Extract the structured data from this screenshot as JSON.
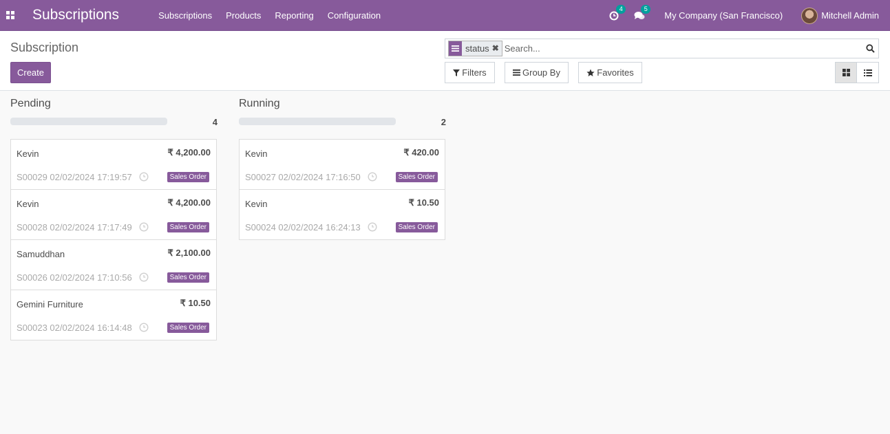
{
  "navbar": {
    "app_title": "Subscriptions",
    "menu": [
      "Subscriptions",
      "Products",
      "Reporting",
      "Configuration"
    ],
    "activity_count": "4",
    "messages_count": "5",
    "company": "My Company (San Francisco)",
    "user": "Mitchell Admin"
  },
  "control_panel": {
    "breadcrumb": "Subscription",
    "create_label": "Create",
    "facet_label": "status",
    "search_placeholder": "Search...",
    "filters_label": "Filters",
    "group_by_label": "Group By",
    "favorites_label": "Favorites"
  },
  "columns": [
    {
      "title": "Pending",
      "count": "4",
      "cards": [
        {
          "name": "Kevin",
          "amount": "₹ 4,200.00",
          "ref": "S00029 02/02/2024 17:19:57",
          "tag": "Sales Order"
        },
        {
          "name": "Kevin",
          "amount": "₹ 4,200.00",
          "ref": "S00028 02/02/2024 17:17:49",
          "tag": "Sales Order"
        },
        {
          "name": "Samuddhan",
          "amount": "₹ 2,100.00",
          "ref": "S00026 02/02/2024 17:10:56",
          "tag": "Sales Order"
        },
        {
          "name": "Gemini Furniture",
          "amount": "₹ 10.50",
          "ref": "S00023 02/02/2024 16:14:48",
          "tag": "Sales Order"
        }
      ]
    },
    {
      "title": "Running",
      "count": "2",
      "cards": [
        {
          "name": "Kevin",
          "amount": "₹ 420.00",
          "ref": "S00027 02/02/2024 17:16:50",
          "tag": "Sales Order"
        },
        {
          "name": "Kevin",
          "amount": "₹ 10.50",
          "ref": "S00024 02/02/2024 16:24:13",
          "tag": "Sales Order"
        }
      ]
    }
  ],
  "colors": {
    "brand": "#875a9b",
    "badge": "#00a09d"
  }
}
